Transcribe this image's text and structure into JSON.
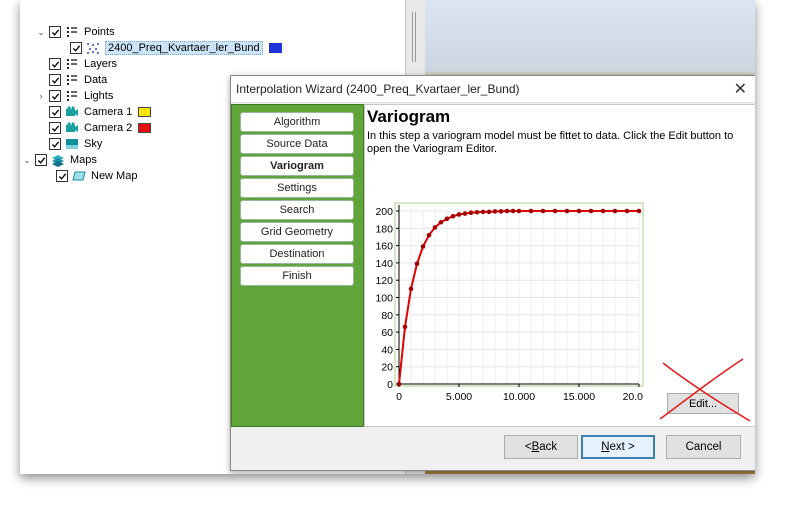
{
  "tree": {
    "items": [
      {
        "label": "Points",
        "expanded": true,
        "icon": "points-group-icon"
      },
      {
        "label": "2400_Preq_Kvartaer_ler_Bund",
        "swatch": "#1e35d8",
        "icon": "scatter-points-icon"
      },
      {
        "label": "Layers",
        "icon": "layers-group-icon"
      },
      {
        "label": "Data",
        "icon": "data-group-icon"
      },
      {
        "label": "Lights",
        "icon": "lights-group-icon"
      },
      {
        "label": "Camera 1",
        "swatch": "#ffe600",
        "icon": "camera-icon"
      },
      {
        "label": "Camera 2",
        "swatch": "#e01010",
        "icon": "camera-icon"
      },
      {
        "label": "Sky",
        "icon": "sky-icon"
      },
      {
        "label": "Maps",
        "icon": "maps-icon"
      },
      {
        "label": "New Map",
        "icon": "new-map-icon"
      }
    ]
  },
  "dialog": {
    "title": "Interpolation Wizard (2400_Preq_Kvartaer_ler_Bund)",
    "close_symbol": "✕",
    "steps": [
      "Algorithm",
      "Source Data",
      "Variogram",
      "Settings",
      "Search",
      "Grid Geometry",
      "Destination",
      "Finish"
    ],
    "active_step": "Variogram",
    "heading": "Variogram",
    "description": "In this step a variogram model must be fittet to data.  Click the Edit button to open the Variogram Editor.",
    "edit_label": "Edit...",
    "back_prefix": "< ",
    "back_accel": "B",
    "back_rest": "ack",
    "next_accel": "N",
    "next_rest": "ext >",
    "cancel_label": "Cancel"
  },
  "chart_data": {
    "type": "line",
    "x": [
      0,
      500,
      1000,
      1500,
      2000,
      2500,
      3000,
      3500,
      4000,
      4500,
      5000,
      5500,
      6000,
      6500,
      7000,
      7500,
      8000,
      8500,
      9000,
      9500,
      10000,
      11000,
      12000,
      13000,
      14000,
      15000,
      16000,
      17000,
      18000,
      19000,
      20000
    ],
    "values": [
      0,
      66,
      110,
      139,
      159,
      172,
      181,
      187,
      191,
      194,
      196,
      197,
      198,
      198.5,
      199,
      199,
      199.5,
      199.5,
      200,
      200,
      200,
      200,
      200,
      200,
      200,
      200,
      200,
      200,
      200,
      200,
      200
    ],
    "xlim": [
      0,
      20000
    ],
    "ylim": [
      0,
      200
    ],
    "yticks": [
      "200",
      "180",
      "160",
      "140",
      "120",
      "100",
      "80",
      "60",
      "40",
      "20",
      "0"
    ],
    "xticks": [
      "0",
      "5.000",
      "10.000",
      "15.000",
      "20.0"
    ],
    "grid": true,
    "line_color": "#e00000",
    "marker_color": "#a00000"
  }
}
